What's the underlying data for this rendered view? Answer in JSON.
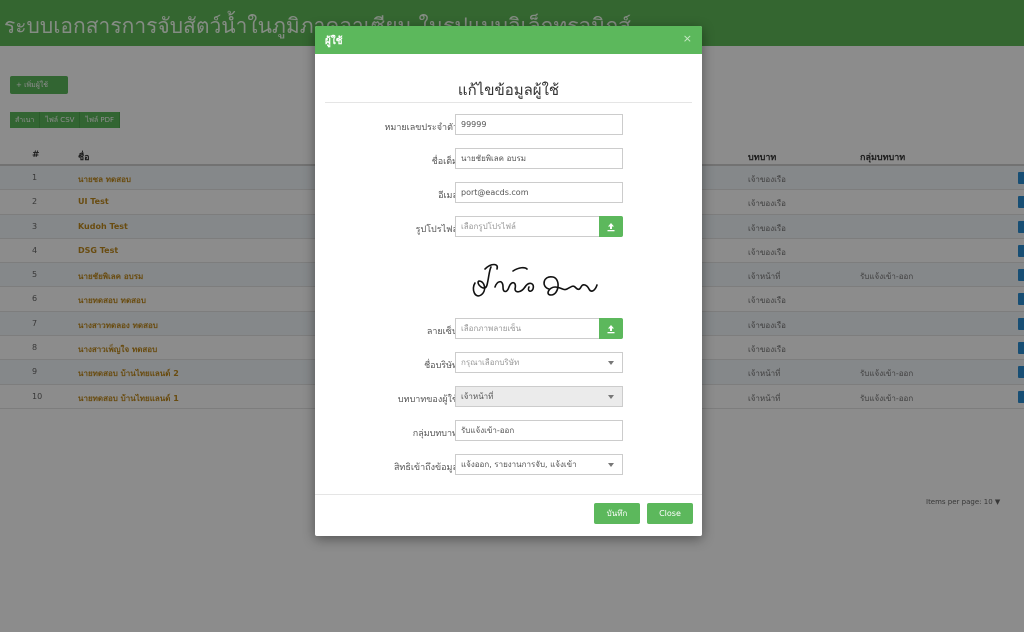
{
  "app": {
    "title": "ระบบเอกสารการจับสัตว์น้ำในภูมิภาคอาเซียน ในรูปแบบอิเล็กทรอนิกส์",
    "add_user_label": "+ เพิ่มผู้ใช้",
    "export_buttons": [
      "สำเนา",
      "ไฟล์ CSV",
      "ไฟล์ PDF"
    ]
  },
  "table": {
    "headers": {
      "num": "#",
      "name": "ชื่อ",
      "role": "บทบาท",
      "group": "กลุ่มบทบาท"
    },
    "rows": [
      {
        "num": "1",
        "name": "นายชล ทดสอบ",
        "role": "เจ้าของเรือ",
        "group": ""
      },
      {
        "num": "2",
        "name": "UI Test",
        "role": "เจ้าของเรือ",
        "group": ""
      },
      {
        "num": "3",
        "name": "Kudoh Test",
        "role": "เจ้าของเรือ",
        "group": ""
      },
      {
        "num": "4",
        "name": "DSG Test",
        "role": "เจ้าของเรือ",
        "group": ""
      },
      {
        "num": "5",
        "name": "นายชัยพิเลค อบรม",
        "role": "เจ้าหน้าที่",
        "group": "รับแจ้งเข้า-ออก"
      },
      {
        "num": "6",
        "name": "นายทดสอบ ทดสอบ",
        "role": "เจ้าของเรือ",
        "group": ""
      },
      {
        "num": "7",
        "name": "นางสาวทดลอง ทดสอบ",
        "role": "เจ้าของเรือ",
        "group": ""
      },
      {
        "num": "8",
        "name": "นางสาวเพ็ญใจ ทดสอบ",
        "role": "เจ้าของเรือ",
        "group": ""
      },
      {
        "num": "9",
        "name": "นายทดสอบ บ้านไทยแลนด์ 2",
        "role": "เจ้าหน้าที่",
        "group": "รับแจ้งเข้า-ออก"
      },
      {
        "num": "10",
        "name": "นายทดสอบ บ้านไทยแลนด์ 1",
        "role": "เจ้าหน้าที่",
        "group": "รับแจ้งเข้า-ออก"
      }
    ],
    "items_per_page_label": "Items per page:",
    "items_per_page_value": "10 ▼"
  },
  "modal": {
    "header_title": "ผู้ใช้",
    "close_x": "×",
    "heading": "แก้ไขข้อมูลผู้ใช้",
    "fields": {
      "id_number": {
        "label": "หมายเลขประจำตัว",
        "value": "99999"
      },
      "login_name": {
        "label": "ชื่อเต็ม",
        "value": "นายชัยพิเลค อบรม"
      },
      "email": {
        "label": "อีเมล",
        "value": "port@eacds.com"
      },
      "profile_picture": {
        "label": "รูปโปรไฟล์",
        "placeholder": "เลือกรูปโปรไฟล์"
      },
      "signature": {
        "label": "ลายเซ็น",
        "placeholder": "เลือกภาพลายเซ็น"
      },
      "company": {
        "label": "ชื่อบริษัท",
        "placeholder": "กรุณาเลือกบริษัท"
      },
      "user_role": {
        "label": "บทบาทของผู้ใช้",
        "value": "เจ้าหน้าที่"
      },
      "role_group": {
        "label": "กลุ่มบทบาท",
        "value": "รับแจ้งเข้า-ออก"
      },
      "access_rights": {
        "label": "สิทธิเข้าถึงข้อมูล",
        "value": "แจ้งออก, รายงานการจับ, แจ้งเข้า"
      }
    },
    "save_label": "บันทึก",
    "close_label": "Close"
  },
  "colors": {
    "brand_green": "#5cb85c",
    "header_green": "#5fba58",
    "name_link": "#c08a1e",
    "row_action": "#2a8fd4"
  },
  "icons": [
    "upload-icon",
    "caret-down-icon",
    "signature-image"
  ]
}
